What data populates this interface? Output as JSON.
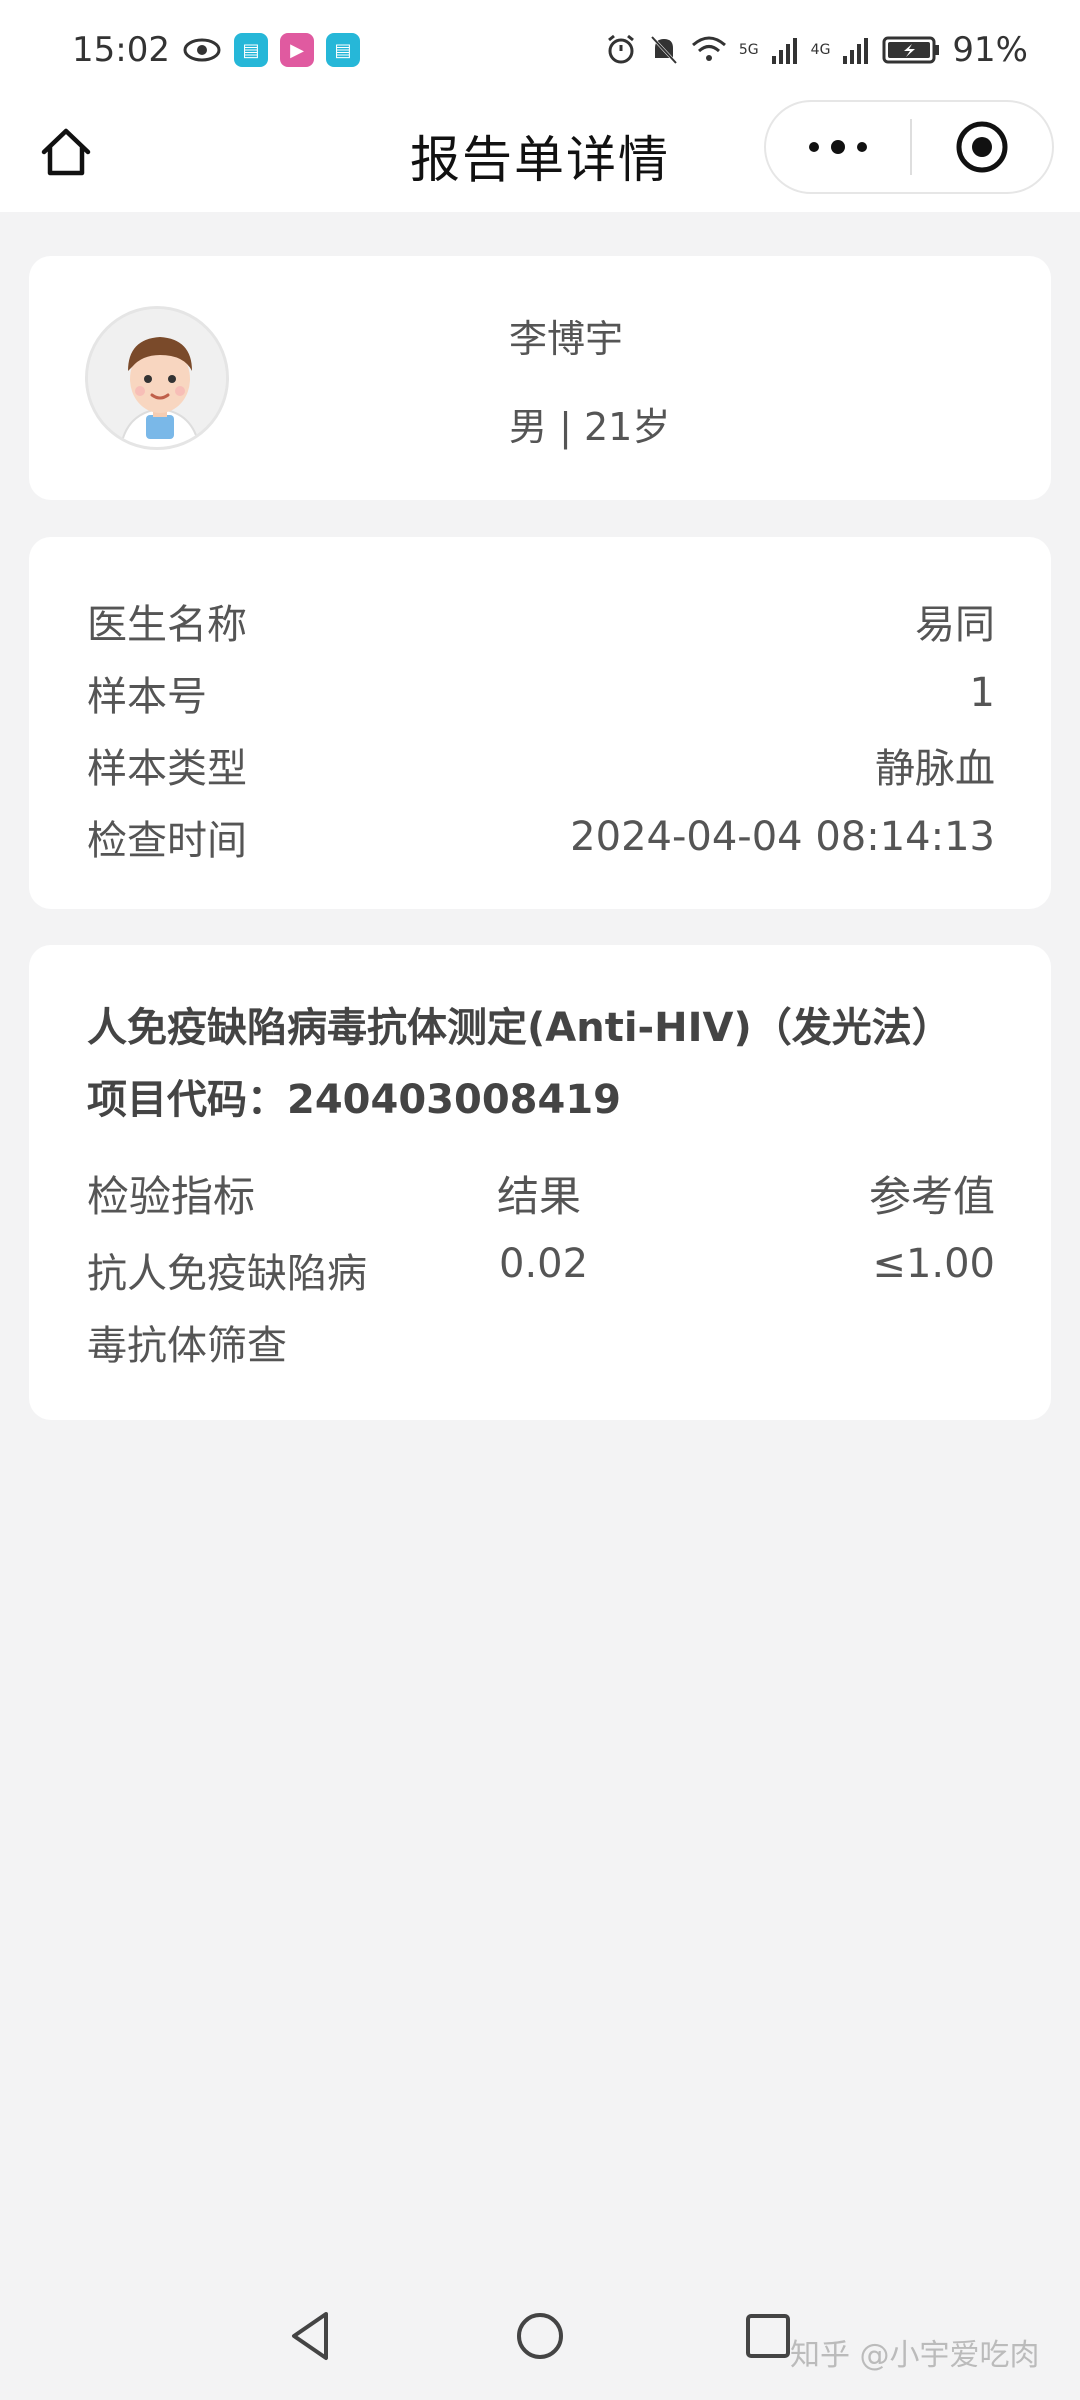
{
  "status_bar": {
    "time": "15:02",
    "battery": "91%",
    "signal_5g": "5G",
    "signal_4g": "4G"
  },
  "nav": {
    "title": "报告单详情"
  },
  "patient": {
    "name": "李博宇",
    "info": "男 | 21岁"
  },
  "details": {
    "rows": [
      {
        "label": "医生名称",
        "value": "易同"
      },
      {
        "label": "样本号",
        "value": "1"
      },
      {
        "label": "样本类型",
        "value": "静脉血"
      },
      {
        "label": "检查时间",
        "value": "2024-04-04 08:14:13"
      }
    ]
  },
  "test": {
    "title": "人免疫缺陷病毒抗体测定(Anti-HIV)（发光法）",
    "code": "项目代码：240403008419",
    "header_indicator": "检验指标",
    "header_result": "结果",
    "header_reference": "参考值",
    "row_indicator_line1": "抗人免疫缺陷病",
    "row_indicator_line2": "毒抗体筛查",
    "row_result": "0.02",
    "row_reference": "≤1.00"
  },
  "watermark": "知乎 @小宇爱吃肉",
  "colors": {
    "background": "#f3f3f4",
    "card": "#ffffff",
    "text": "#555555"
  }
}
